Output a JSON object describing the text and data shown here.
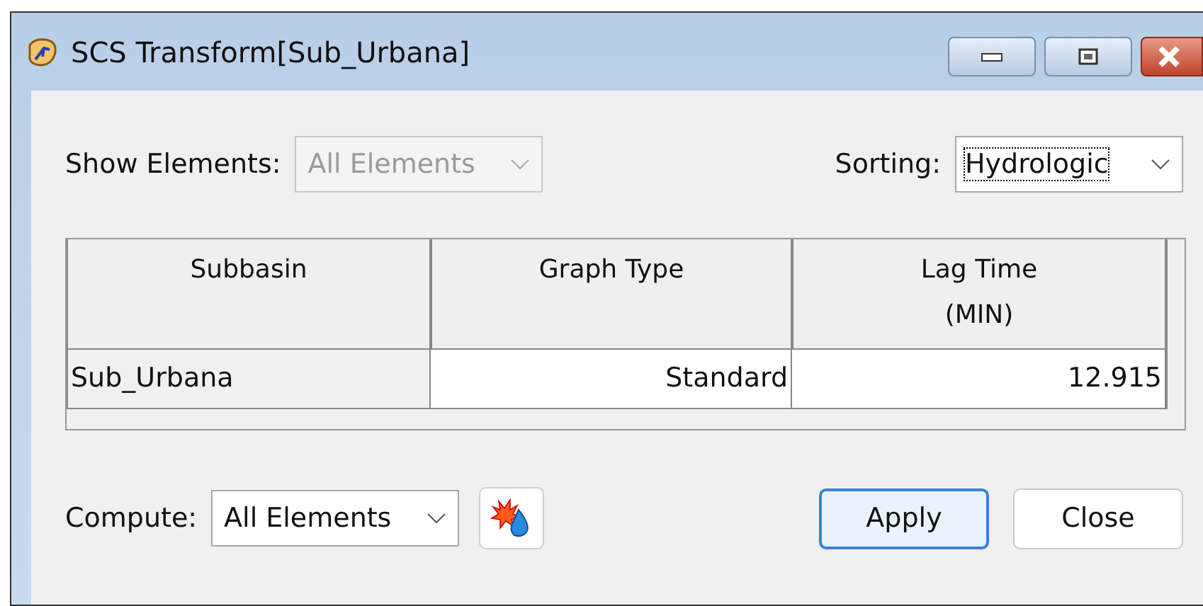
{
  "window": {
    "title": "SCS Transform[Sub_Urbana]"
  },
  "show_elements": {
    "label": "Show Elements:",
    "value": "All Elements",
    "disabled": true
  },
  "sorting": {
    "label": "Sorting:",
    "value": "Hydrologic",
    "focused": true
  },
  "table": {
    "columns": [
      {
        "label": "Subbasin"
      },
      {
        "label": "Graph Type"
      },
      {
        "label": "Lag Time",
        "unit": "(MIN)"
      }
    ],
    "rows": [
      [
        "Sub_Urbana",
        "Standard",
        "12.915"
      ]
    ]
  },
  "compute": {
    "label": "Compute:",
    "value": "All Elements"
  },
  "buttons": [
    {
      "label": "Apply",
      "default": true
    },
    {
      "label": "Close",
      "default": false
    }
  ]
}
